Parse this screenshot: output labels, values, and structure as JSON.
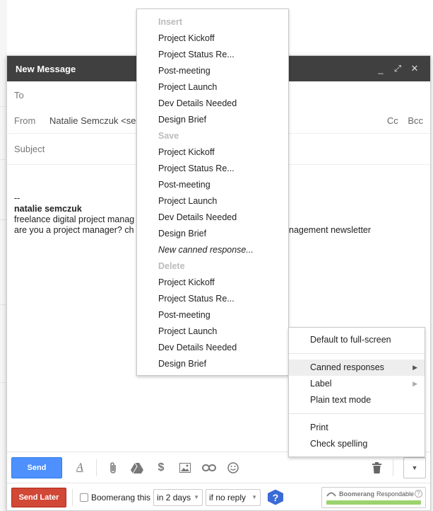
{
  "compose": {
    "title": "New Message",
    "controls": {
      "minimize": "_",
      "expand": "⤢",
      "close": "✕"
    },
    "to_label": "To",
    "from_label": "From",
    "from_value": "Natalie Semczuk <sem",
    "cc": "Cc",
    "bcc": "Bcc",
    "subject_placeholder": "Subject",
    "signature": {
      "dashes": "--",
      "name": "natalie semczuk",
      "line1": "freelance digital project manag",
      "line2": "are you a project manager? ch",
      "line2_tail": "nagement newsletter"
    }
  },
  "canned_menu": {
    "insert_header": "Insert",
    "insert_items": [
      "Project Kickoff",
      "Project Status Re...",
      "Post-meeting",
      "Project Launch",
      "Dev Details Needed",
      "Design Brief"
    ],
    "save_header": "Save",
    "save_items": [
      "Project Kickoff",
      "Project Status Re...",
      "Post-meeting",
      "Project Launch",
      "Dev Details Needed",
      "Design Brief"
    ],
    "new_response": "New canned response...",
    "delete_header": "Delete",
    "delete_items": [
      "Project Kickoff",
      "Project Status Re...",
      "Post-meeting",
      "Project Launch",
      "Dev Details Needed",
      "Design Brief"
    ]
  },
  "more_menu": {
    "default_fullscreen": "Default to full-screen",
    "canned_responses": "Canned responses",
    "label": "Label",
    "plain_text": "Plain text mode",
    "print": "Print",
    "check_spelling": "Check spelling"
  },
  "toolbar": {
    "send": "Send",
    "format_icon": "A",
    "more_arrow": "▼"
  },
  "boomerang": {
    "send_later": "Send Later",
    "boomerang_this": "Boomerang this",
    "when": "in 2 days",
    "condition": "if no reply",
    "help": "?",
    "respondable_brand": "Boomerang",
    "respondable_label": "Respondable",
    "respondable_help": "?"
  },
  "colors": {
    "send_blue": "#4d90fe",
    "send_later_red": "#d14836",
    "titlebar": "#404040"
  }
}
